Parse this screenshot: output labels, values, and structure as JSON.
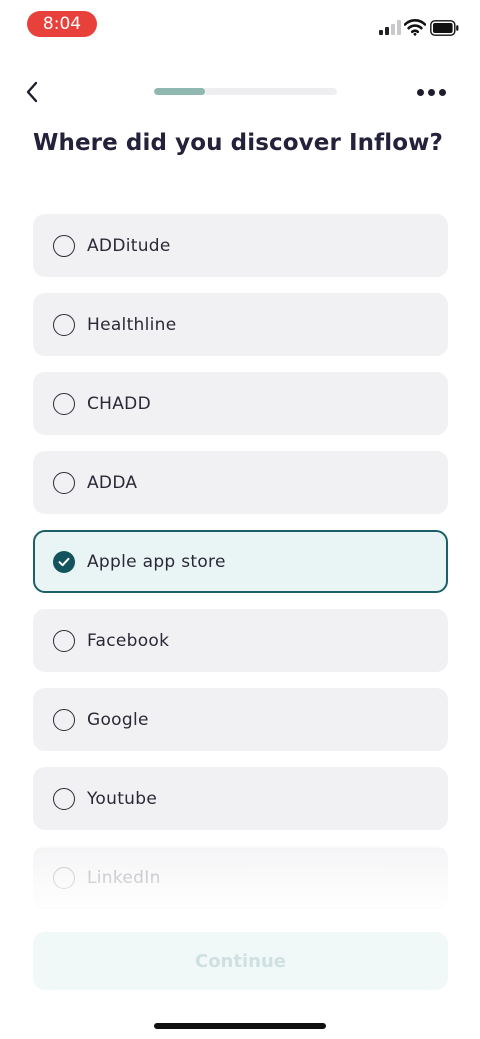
{
  "status_bar": {
    "time": "8:04"
  },
  "header": {
    "progress_fraction": 0.28
  },
  "page": {
    "title": "Where did you discover Inflow?"
  },
  "options": [
    {
      "label": "ADDitude",
      "selected": false
    },
    {
      "label": "Healthline",
      "selected": false
    },
    {
      "label": "CHADD",
      "selected": false
    },
    {
      "label": "ADDA",
      "selected": false
    },
    {
      "label": "Apple app store",
      "selected": true
    },
    {
      "label": "Facebook",
      "selected": false
    },
    {
      "label": "Google",
      "selected": false
    },
    {
      "label": "Youtube",
      "selected": false
    },
    {
      "label": "LinkedIn",
      "selected": false
    }
  ],
  "footer": {
    "continue_label": "Continue"
  },
  "colors": {
    "accent": "#13535d",
    "progress": "#8fb8b0",
    "time_pill": "#e8413c",
    "option_bg": "#f1f0f2",
    "selected_bg": "#e9f4f4"
  }
}
